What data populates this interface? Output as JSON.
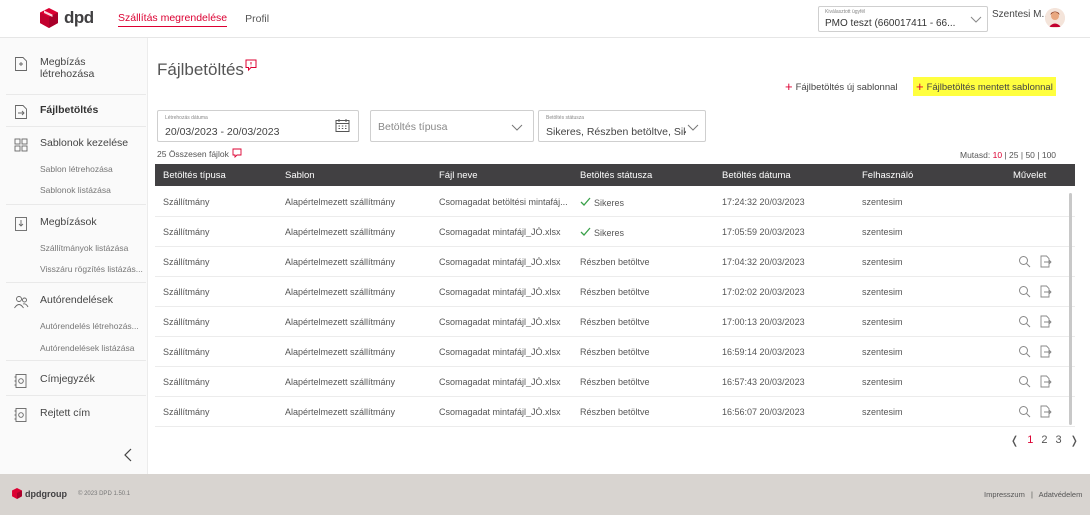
{
  "brand": {
    "logo_text": "dpd",
    "accent": "#dc0032",
    "dark": "#414042"
  },
  "topnav": [
    {
      "label": "Szállítás megrendelése",
      "active": true
    },
    {
      "label": "Profil",
      "active": false
    }
  ],
  "client": {
    "caption": "Kiválasztott ügyfél",
    "value": "PMO teszt (660017411 - 66..."
  },
  "user": {
    "name": "Szentesi M..."
  },
  "sidebar": {
    "items": [
      {
        "label": "Megbízás létrehozása",
        "icon": "document-add-icon"
      },
      {
        "label": "Fájlbetöltés",
        "icon": "file-upload-icon"
      },
      {
        "label": "Sablonok kezelése",
        "icon": "grid-icon"
      },
      {
        "label": "Megbízások",
        "icon": "orders-icon"
      },
      {
        "label": "Autórendelések",
        "icon": "people-icon"
      },
      {
        "label": "Címjegyzék",
        "icon": "address-book-icon"
      },
      {
        "label": "Rejtett cím",
        "icon": "hidden-address-icon"
      }
    ],
    "sub_templates": [
      "Sablon létrehozása",
      "Sablonok listázása"
    ],
    "sub_orders": [
      "Szállítmányok listázása",
      "Visszáru rögzítés listázás..."
    ],
    "sub_auto": [
      "Autórendelés létrehozás...",
      "Autórendelések listázása"
    ]
  },
  "page": {
    "title": "Fájlbetöltés",
    "action_new": "Fájlbetöltés új sablonnal",
    "action_saved": "Fájlbetöltés mentett sablonnal"
  },
  "filters": {
    "date": {
      "caption": "Létrehozás dátuma",
      "value": "20/03/2023 - 20/03/2023"
    },
    "type": {
      "placeholder": "Betöltés típusa"
    },
    "status": {
      "caption": "Betöltés státusza",
      "value": "Sikeres, Részben betöltve, Sike"
    }
  },
  "total": "25 Összesen fájlok",
  "page_size": {
    "label": "Mutasd:",
    "options": [
      "10",
      "25",
      "50",
      "100"
    ],
    "selected": "10"
  },
  "table": {
    "headers": [
      "Betöltés típusa",
      "Sablon",
      "Fájl neve",
      "Betöltés státusza",
      "Betöltés dátuma",
      "Felhasználó",
      "Művelet"
    ],
    "rows": [
      {
        "type": "Szállítmány",
        "template": "Alapértelmezett szállítmány",
        "file": "Csomagadat betöltési mintafáj...",
        "status": "Sikeres",
        "ok": true,
        "date": "17:24:32 20/03/2023",
        "user": "szentesim",
        "actions": false
      },
      {
        "type": "Szállítmány",
        "template": "Alapértelmezett szállítmány",
        "file": "Csomagadat mintafájl_JÓ.xlsx",
        "status": "Sikeres",
        "ok": true,
        "date": "17:05:59 20/03/2023",
        "user": "szentesim",
        "actions": false
      },
      {
        "type": "Szállítmány",
        "template": "Alapértelmezett szállítmány",
        "file": "Csomagadat mintafájl_JÓ.xlsx",
        "status": "Részben betöltve",
        "ok": false,
        "date": "17:04:32 20/03/2023",
        "user": "szentesim",
        "actions": true
      },
      {
        "type": "Szállítmány",
        "template": "Alapértelmezett szállítmány",
        "file": "Csomagadat mintafájl_JÓ.xlsx",
        "status": "Részben betöltve",
        "ok": false,
        "date": "17:02:02 20/03/2023",
        "user": "szentesim",
        "actions": true
      },
      {
        "type": "Szállítmány",
        "template": "Alapértelmezett szállítmány",
        "file": "Csomagadat mintafájl_JÓ.xlsx",
        "status": "Részben betöltve",
        "ok": false,
        "date": "17:00:13 20/03/2023",
        "user": "szentesim",
        "actions": true
      },
      {
        "type": "Szállítmány",
        "template": "Alapértelmezett szállítmány",
        "file": "Csomagadat mintafájl_JÓ.xlsx",
        "status": "Részben betöltve",
        "ok": false,
        "date": "16:59:14 20/03/2023",
        "user": "szentesim",
        "actions": true
      },
      {
        "type": "Szállítmány",
        "template": "Alapértelmezett szállítmány",
        "file": "Csomagadat mintafájl_JÓ.xlsx",
        "status": "Részben betöltve",
        "ok": false,
        "date": "16:57:43 20/03/2023",
        "user": "szentesim",
        "actions": true
      },
      {
        "type": "Szállítmány",
        "template": "Alapértelmezett szállítmány",
        "file": "Csomagadat mintafájl_JÓ.xlsx",
        "status": "Részben betöltve",
        "ok": false,
        "date": "16:56:07 20/03/2023",
        "user": "szentesim",
        "actions": true
      }
    ]
  },
  "pagination": {
    "pages": [
      "1",
      "2",
      "3"
    ],
    "current": "1"
  },
  "footer": {
    "brand": "dpdgroup",
    "copyright": "© 2023 DPD 1.50.1",
    "links": [
      "Impresszum",
      "Adatvédelem"
    ]
  }
}
